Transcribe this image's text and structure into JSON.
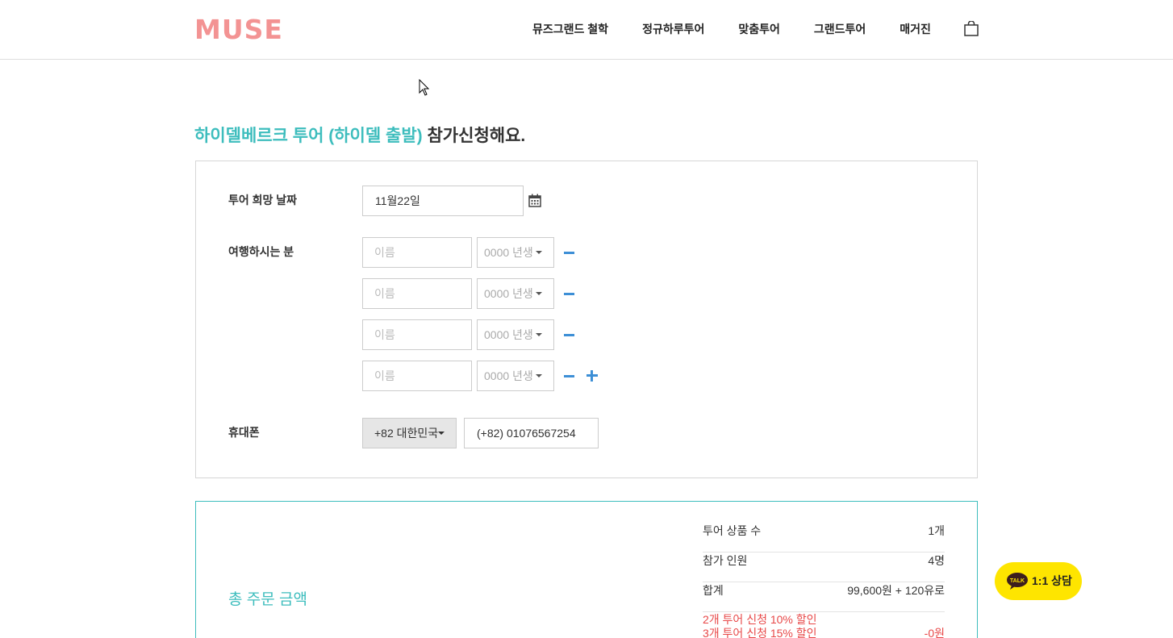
{
  "header": {
    "logo": "MUSE",
    "nav": [
      "뮤즈그랜드 철학",
      "정규하루투어",
      "맞춤투어",
      "그랜드투어",
      "매거진"
    ],
    "icons": {
      "cart": "shopping-bag-icon"
    }
  },
  "title": {
    "highlight": "하이델베르크 투어 (하이델 출발)",
    "rest": " 참가신청해요."
  },
  "form": {
    "date_label": "투어 희망 날짜",
    "date_value": "11월22일",
    "travelers_label": "여행하시는 분",
    "travelers": [
      {
        "name_placeholder": "이름",
        "year_placeholder": "0000 년생"
      },
      {
        "name_placeholder": "이름",
        "year_placeholder": "0000 년생"
      },
      {
        "name_placeholder": "이름",
        "year_placeholder": "0000 년생"
      },
      {
        "name_placeholder": "이름",
        "year_placeholder": "0000 년생"
      }
    ],
    "phone_label": "휴대폰",
    "country_code": "+82 대한민국",
    "phone_value": "(+82) 01076567254"
  },
  "summary": {
    "total_label": "총 주문 금액",
    "rows": [
      {
        "label": "투어 상품 수",
        "value": "1개"
      },
      {
        "label": "참가 인원",
        "value": "4명"
      },
      {
        "label": "합계",
        "value": "99,600원 + 120유로"
      }
    ],
    "discount_line1": "2개 투어 신청 10% 할인",
    "discount_line2": "3개 투어 신청 15% 할인",
    "discount_value": "-0원"
  },
  "talk": {
    "label": "1:1 상담",
    "bubble": "TALK"
  },
  "colors": {
    "accent": "#3dbdbd",
    "logo": "#f39393",
    "icon_blue": "#3d8fd6",
    "discount": "#e84848",
    "talk_bg": "#fee500"
  }
}
